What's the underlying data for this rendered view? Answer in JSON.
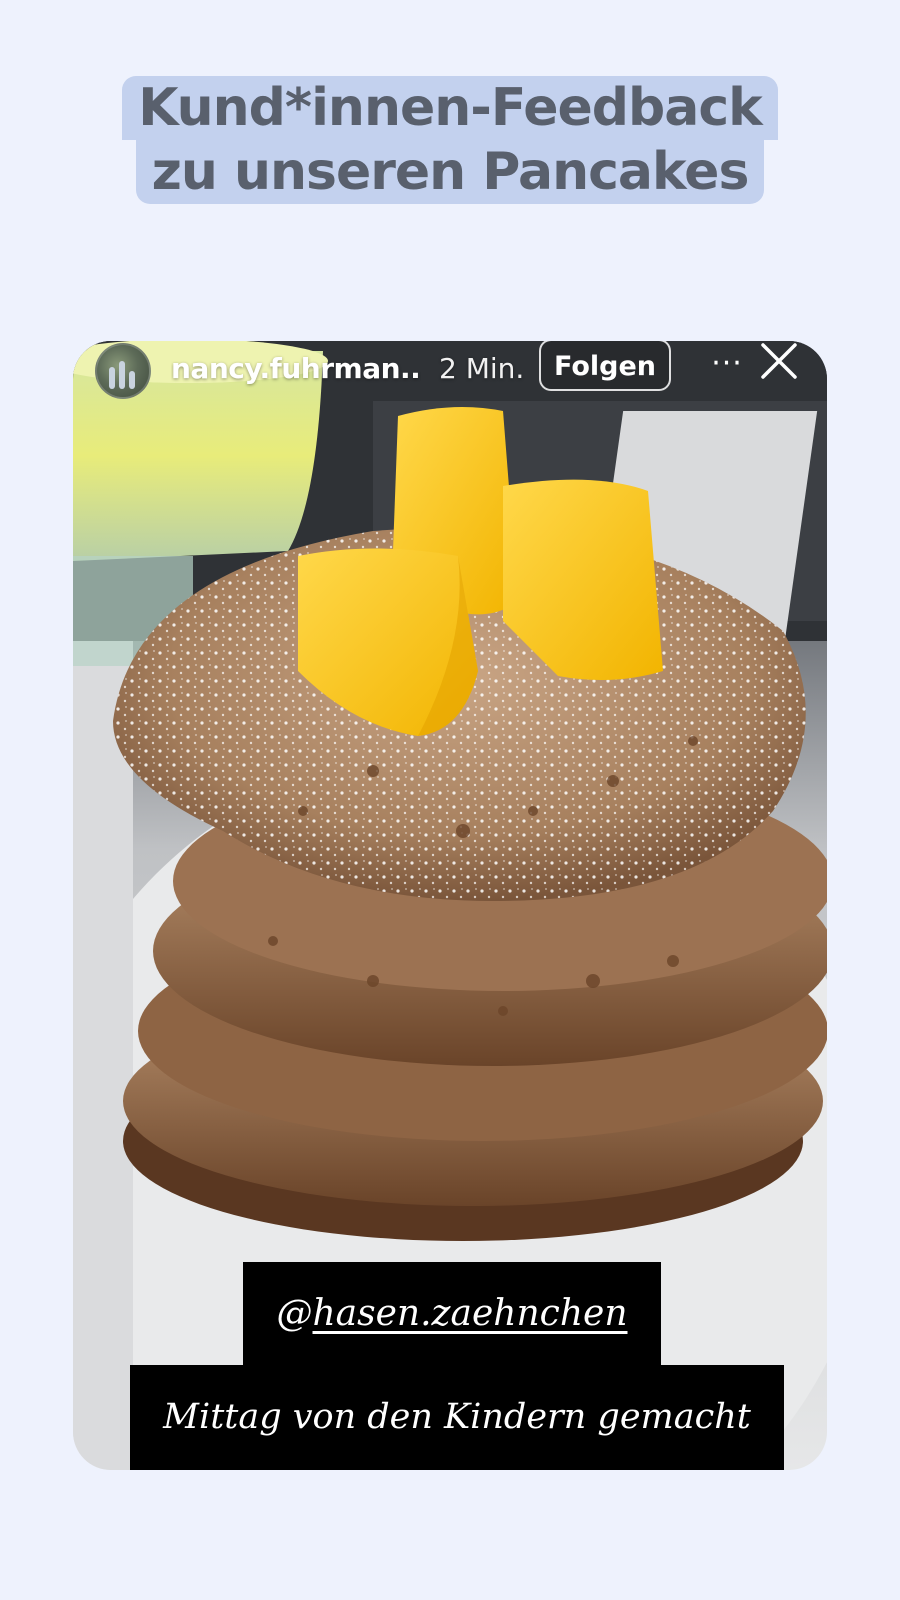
{
  "headline": {
    "line1": "Kund*innen-Feedback",
    "line2": "zu unseren Pancakes"
  },
  "story": {
    "username": "nancy.fuhrman...",
    "time": "2 Min.",
    "follow_label": "Folgen",
    "more_label": "···",
    "mention_prefix": "@",
    "mention_handle": "hasen.zaehnchen",
    "caption": "Mittag von den Kindern gemacht"
  },
  "colors": {
    "page_background": "#eef2fd",
    "headline_highlight": "#c3d1ee",
    "headline_text": "#59606d"
  },
  "icons": [
    "more-icon",
    "close-icon",
    "avatar"
  ]
}
